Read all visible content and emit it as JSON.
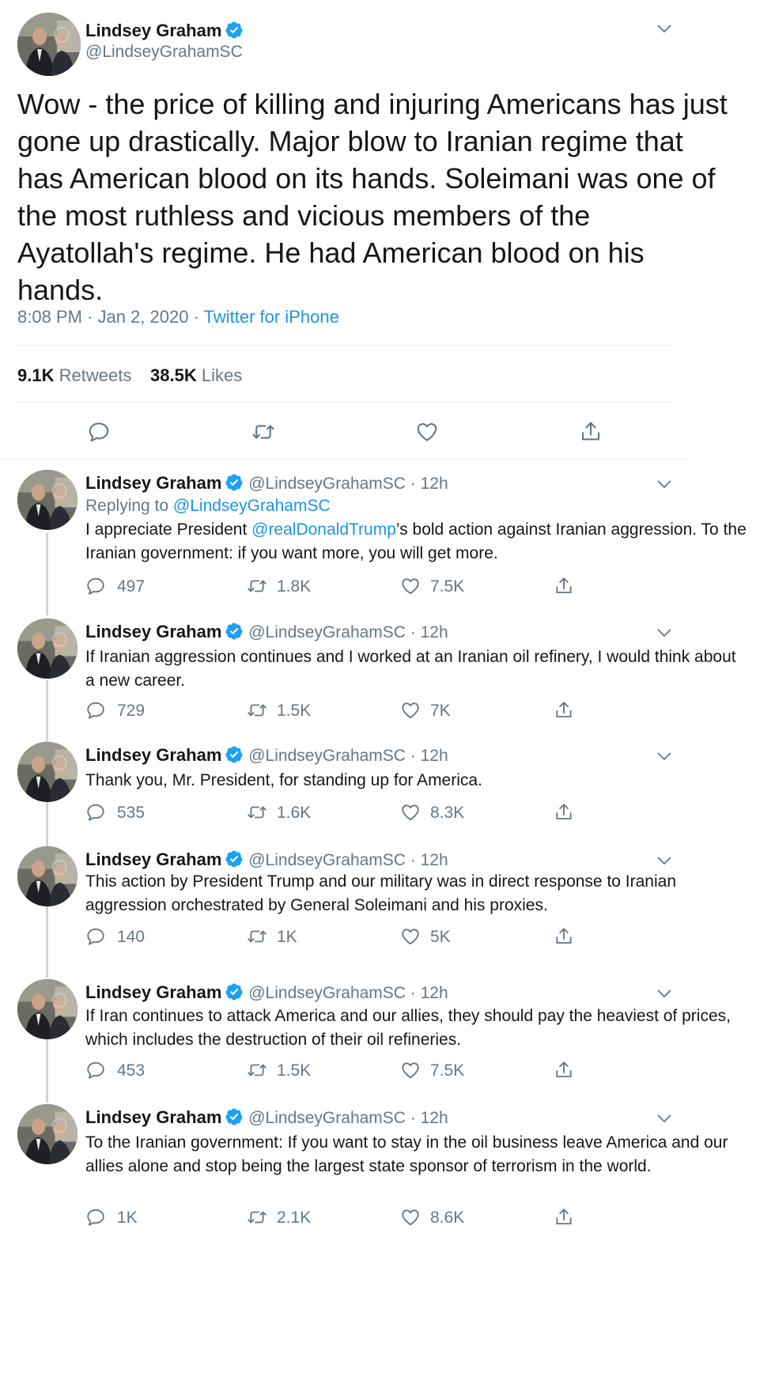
{
  "main": {
    "name": "Lindsey Graham",
    "handle": "@LindseyGrahamSC",
    "text": "Wow - the price of killing and injuring Americans has just gone up drastically. Major blow to Iranian regime that has American blood on its hands. Soleimani was one of the most ruthless and vicious members of the Ayatollah's regime.  He had American blood on his hands.",
    "time": "8:08 PM · Jan 2, 2020 · ",
    "source": "Twitter for iPhone",
    "retweets_count": "9.1K",
    "retweets_label": "Retweets",
    "likes_count": "38.5K",
    "likes_label": "Likes"
  },
  "replies": [
    {
      "name": "Lindsey Graham",
      "meta": "@LindseyGrahamSC · 12h",
      "replying_prefix": "Replying to ",
      "replying_to": "@LindseyGrahamSC",
      "text_before": "I appreciate President ",
      "mention": "@realDonaldTrump",
      "text_after": "’s bold action against Iranian aggression. To the Iranian government: if you want more, you will get more.",
      "replies": "497",
      "retweets": "1.8K",
      "likes": "7.5K"
    },
    {
      "name": "Lindsey Graham",
      "meta": "@LindseyGrahamSC · 12h",
      "text": "If Iranian aggression continues and I worked at an Iranian oil refinery, I would think about a new career.",
      "replies": "729",
      "retweets": "1.5K",
      "likes": "7K"
    },
    {
      "name": "Lindsey Graham",
      "meta": "@LindseyGrahamSC · 12h",
      "text": "Thank you, Mr. President, for standing up for America.",
      "replies": "535",
      "retweets": "1.6K",
      "likes": "8.3K"
    },
    {
      "name": "Lindsey Graham",
      "meta": "@LindseyGrahamSC · 12h",
      "text": "This action by President Trump and our military was in direct response to Iranian aggression orchestrated by General Soleimani and his proxies.",
      "replies": "140",
      "retweets": "1K",
      "likes": "5K"
    },
    {
      "name": "Lindsey Graham",
      "meta": "@LindseyGrahamSC · 12h",
      "text": "If Iran continues to attack America and our allies, they should pay the heaviest of prices, which includes the destruction of their oil refineries.",
      "replies": "453",
      "retweets": "1.5K",
      "likes": "7.5K"
    },
    {
      "name": "Lindsey Graham",
      "meta": "@LindseyGrahamSC · 12h",
      "text": "To the Iranian government:  If you want to stay in the oil business leave America and our allies alone and stop being the largest state sponsor of terrorism in the world.",
      "replies": "1K",
      "retweets": "2.1K",
      "likes": "8.6K"
    }
  ],
  "colors": {
    "accent": "#1b95e0",
    "muted": "#657786",
    "text": "#14171a",
    "divider": "#e6ecf0"
  },
  "icons": [
    "verified-badge-icon",
    "chevron-down-icon",
    "reply-icon",
    "retweet-icon",
    "like-icon",
    "share-icon"
  ]
}
